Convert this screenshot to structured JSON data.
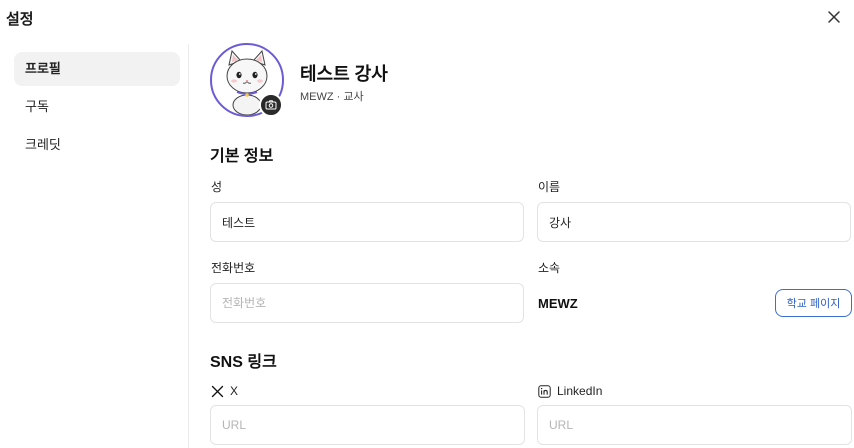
{
  "dialog": {
    "title": "설정",
    "close_icon": "close-icon"
  },
  "sidebar": {
    "items": [
      {
        "label": "프로필",
        "active": true
      },
      {
        "label": "구독",
        "active": false
      },
      {
        "label": "크레딧",
        "active": false
      }
    ]
  },
  "profile": {
    "name": "테스트 강사",
    "subtitle": "MEWZ · 교사",
    "avatar_icon": "cat-avatar-icon",
    "camera_icon": "camera-icon",
    "accent_color": "#6b5bd6"
  },
  "basic_info": {
    "title": "기본 정보",
    "last_name": {
      "label": "성",
      "value": "테스트"
    },
    "first_name": {
      "label": "이름",
      "value": "강사"
    },
    "phone": {
      "label": "전화번호",
      "value": "",
      "placeholder": "전화번호"
    },
    "affiliation": {
      "label": "소속",
      "value": "MEWZ",
      "button_label": "학교 페이지"
    }
  },
  "sns": {
    "title": "SNS 링크",
    "x": {
      "label": "X",
      "icon": "x-logo-icon",
      "value": "",
      "placeholder": "URL"
    },
    "linkedin": {
      "label": "LinkedIn",
      "icon": "linkedin-icon",
      "value": "",
      "placeholder": "URL"
    }
  }
}
